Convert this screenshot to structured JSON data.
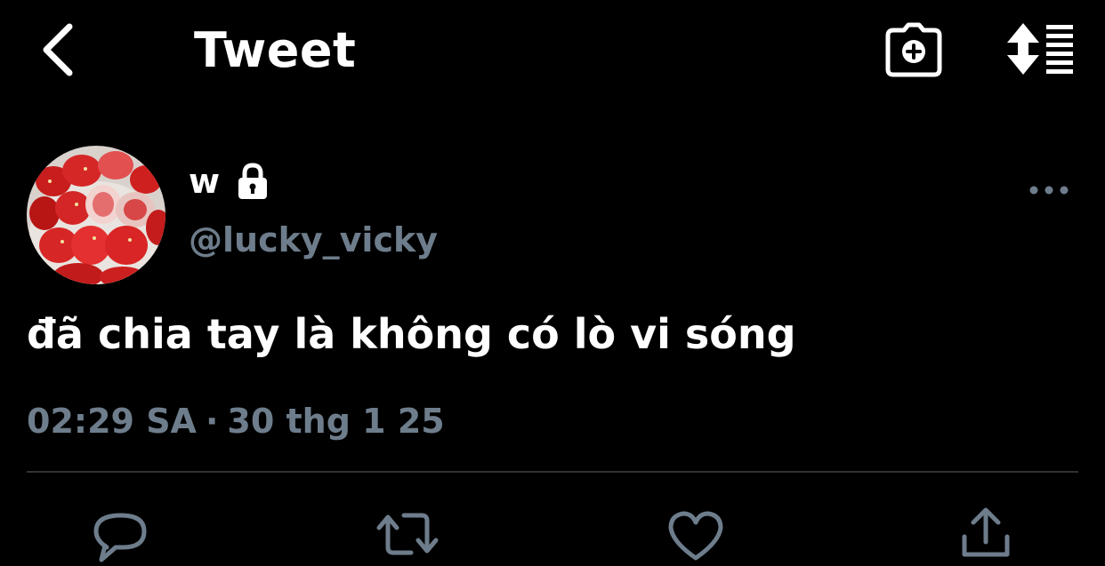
{
  "header": {
    "title": "Tweet",
    "back_icon": "chevron-left-icon",
    "camera_icon": "camera-plus-icon",
    "sort_icon": "sort-lines-icon"
  },
  "tweet": {
    "author": {
      "display_name": "w",
      "handle": "@lucky_vicky",
      "protected_icon": "lock-icon",
      "avatar": "strawberries-avatar"
    },
    "text": "đã chia tay là không có lò vi sóng",
    "time": "02:29 SA",
    "separator": "·",
    "date": "30 thg 1 25",
    "more_icon": "more-horizontal-icon"
  },
  "actions": [
    {
      "name": "reply",
      "icon": "reply-icon"
    },
    {
      "name": "retweet",
      "icon": "retweet-icon"
    },
    {
      "name": "like",
      "icon": "heart-icon"
    },
    {
      "name": "share",
      "icon": "share-icon"
    }
  ],
  "colors": {
    "background": "#000000",
    "text": "#ffffff",
    "muted": "#6e7d8c",
    "divider": "#2f3336"
  }
}
